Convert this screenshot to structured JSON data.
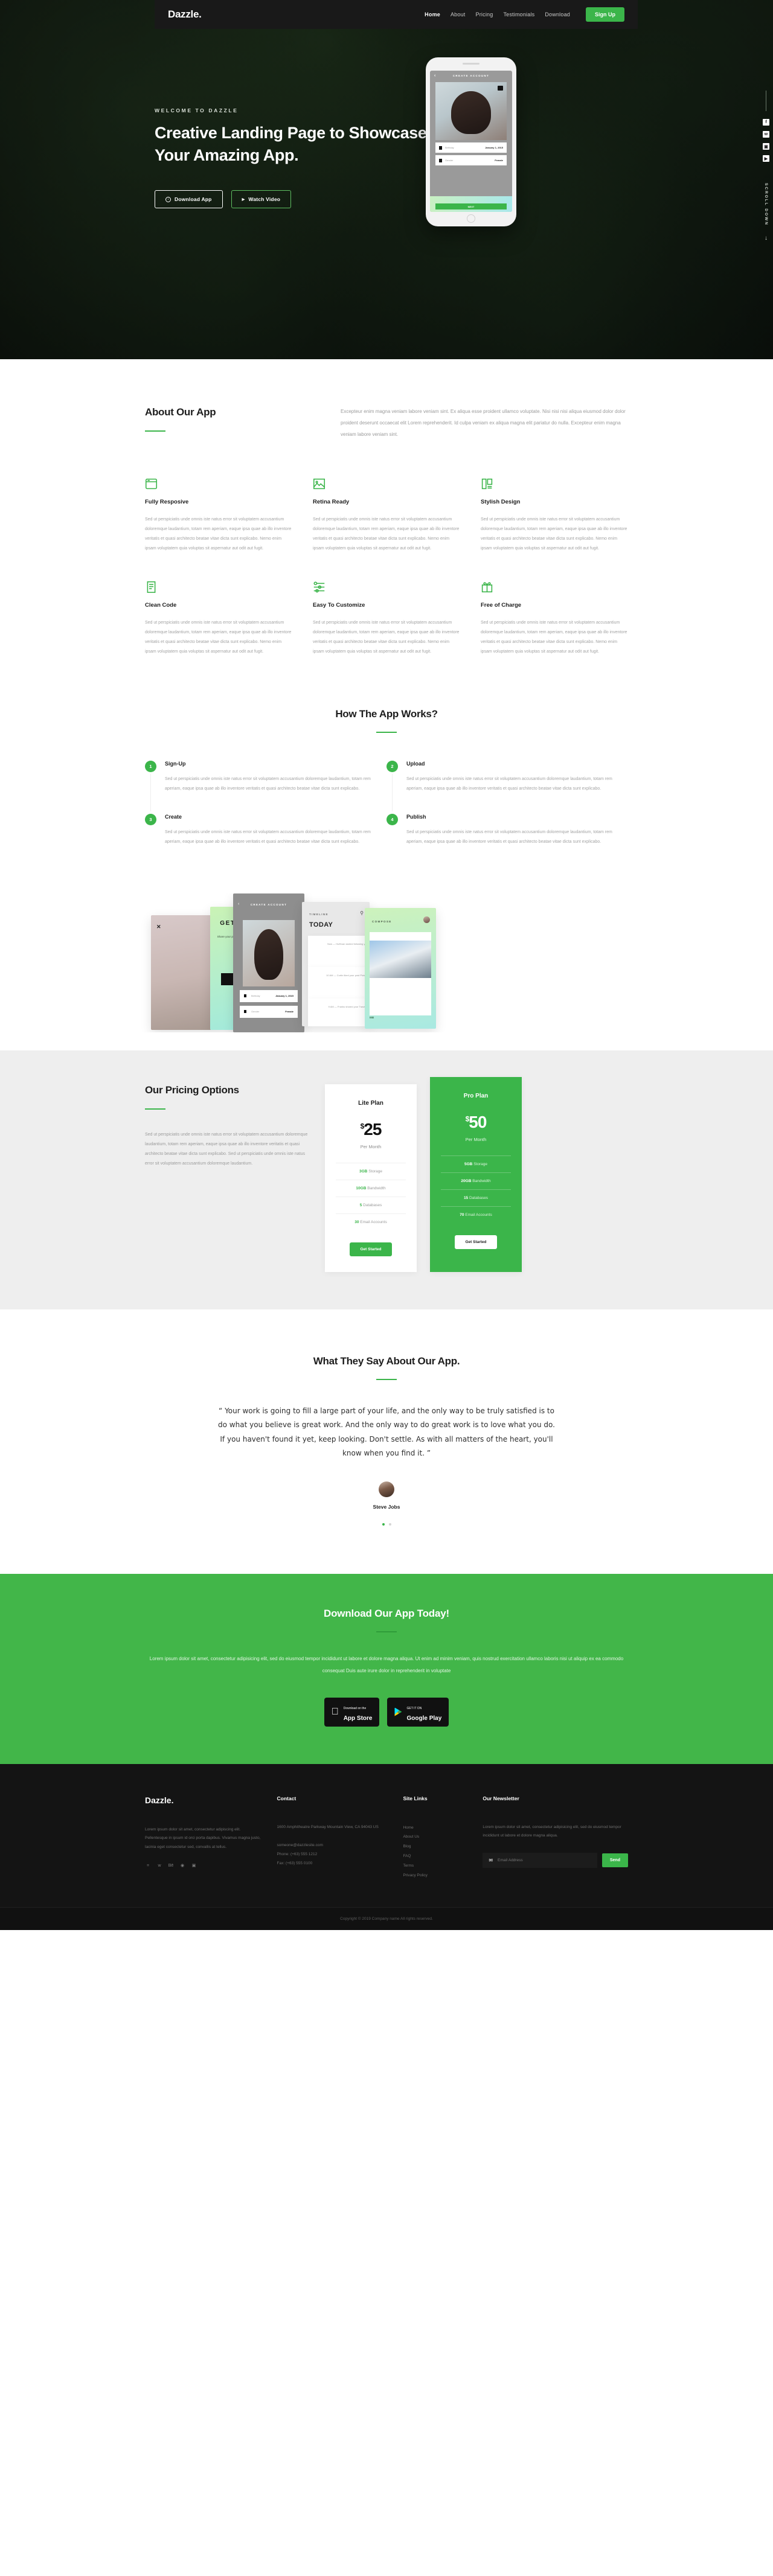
{
  "nav": {
    "brand": "Dazzle.",
    "links": [
      {
        "label": "Home",
        "active": true
      },
      {
        "label": "About",
        "active": false
      },
      {
        "label": "Pricing",
        "active": false
      },
      {
        "label": "Testimonials",
        "active": false
      },
      {
        "label": "Download",
        "active": false
      }
    ],
    "signup": "Sign Up"
  },
  "hero": {
    "eyebrow": "WELCOME TO DAZZLE",
    "heading": "Creative Landing Page to Showcase Your Amazing App.",
    "btn_download": "Download App",
    "btn_watch": "Watch Video",
    "scroll": "SCROLL DOWN",
    "social": [
      "facebook-icon",
      "twitter-icon",
      "instagram-icon",
      "youtube-icon"
    ],
    "phone": {
      "title": "CREATE ACCOUNT",
      "rows": [
        {
          "label": "Birthday",
          "value": "January 1, 2015"
        },
        {
          "label": "Gender",
          "value": "Female"
        }
      ],
      "cta": "NEXT"
    }
  },
  "about": {
    "title": "About Our App",
    "text": "Excepteur enim magna veniam labore veniam sint. Ex aliqua esse proident ullamco voluptate. Nisi nisi nisi aliqua eiusmod dolor dolor proident deserunt occaecat elit Lorem reprehenderit. Id culpa veniam ex aliqua magna elit pariatur do nulla. Excepteur enim magna veniam labore veniam sint."
  },
  "features": {
    "body": "Sed ut perspiciatis unde omnis iste natus error sit voluptatem accusantium doloremque laudantium, totam rem aperiam, eaque ipsa quae ab illo inventore veritatis et quasi architecto beatae vitae dicta sunt explicabo. Nemo enim ipsam voluptatem quia voluptas sit aspernatur aut odit aut fugit.",
    "items": [
      {
        "title": "Fully Resposive",
        "icon": "browser-window-icon"
      },
      {
        "title": "Retina Ready",
        "icon": "image-icon"
      },
      {
        "title": "Stylish Design",
        "icon": "palette-icon"
      },
      {
        "title": "Clean Code",
        "icon": "document-lines-icon"
      },
      {
        "title": "Easy To Customize",
        "icon": "sliders-icon"
      },
      {
        "title": "Free of Charge",
        "icon": "gift-icon"
      }
    ]
  },
  "how": {
    "title": "How The App Works?",
    "body": "Sed ut perspiciatis unde omnis iste natus error sit voluptatem accusantium doloremque laudantium, totam rem aperiam, eaque ipsa quae ab illo inventore veritatis et quasi architecto beatae vitae dicta sunt explicabo.",
    "steps": [
      {
        "num": "1",
        "title": "Sign-Up"
      },
      {
        "num": "2",
        "title": "Upload"
      },
      {
        "num": "3",
        "title": "Create"
      },
      {
        "num": "4",
        "title": "Publish"
      }
    ]
  },
  "shots": {
    "s2_title": "GET STARTED",
    "s2_sub": "Share your photos, videos and stories with your friends.",
    "s3_title": "CREATE ACCOUNT",
    "s3_rows": [
      {
        "label": "Birthday",
        "value": "January 1, 2015"
      },
      {
        "label": "Gender",
        "value": "Female"
      }
    ],
    "s4_tl": "TIMELINE",
    "s4_today": "TODAY",
    "s4_cards": [
      "Now — Huffman started following you",
      "10 AM — Curtin liked your post Pictures",
      "9 AM — Franks shared your Travels"
    ],
    "s5_compose": "COMPOSE",
    "s5_mb": "MB"
  },
  "pricing": {
    "title": "Our Pricing Options",
    "text": "Sed ut perspiciatis unde omnis iste natus error sit voluptatem accusantium doloremque laudantium, totam rem aperiam, eaque ipsa quae ab illo inventore veritatis et quasi architecto beatae vitae dicta sunt explicabo. Sed ut perspiciatis unde omnis iste natus error sit voluptatem accusantium doloremque laudantium.",
    "plans": [
      {
        "name": "Lite Plan",
        "currency": "$",
        "price": "25",
        "period": "Per Month",
        "features": [
          {
            "value": "3GB",
            "label": " Storage"
          },
          {
            "value": "10GB",
            "label": " Bandwidth"
          },
          {
            "value": "5",
            "label": " Databases"
          },
          {
            "value": "30",
            "label": " Email Accounts"
          }
        ],
        "cta": "Get Started",
        "featured": false
      },
      {
        "name": "Pro Plan",
        "currency": "$",
        "price": "50",
        "period": "Per Month",
        "features": [
          {
            "value": "5GB",
            "label": " Storage"
          },
          {
            "value": "20GB",
            "label": " Bandwidth"
          },
          {
            "value": "15",
            "label": " Databases"
          },
          {
            "value": "70",
            "label": " Email Accounts"
          }
        ],
        "cta": "Get Started",
        "featured": true
      }
    ]
  },
  "testimonials": {
    "title": "What They Say About Our App.",
    "quote": "“ Your work is going to fill a large part of your life, and the only way to be truly satisfied is to do what you believe is great work. And the only way to do great work is to love what you do. If you haven't found it yet, keep looking. Don't settle. As with all matters of the heart, you'll know when you find it. ”",
    "author": "Steve Jobs",
    "dots": 2,
    "active_dot": 0
  },
  "cta": {
    "title": "Download Our App Today!",
    "text": "Lorem ipsum dolor sit amet, consectetur adipisicing elit, sed do eiusmod tempor incididunt ut labore et dolore magna aliqua. Ut enim ad minim veniam, quis nostrud exercitation ullamco laboris nisi ut aliquip ex ea commodo consequat Duis aute irure dolor in reprehenderit in voluptate",
    "store_apple_small": "Download on the",
    "store_apple_big": "App Store",
    "store_google_small": "GET IT ON",
    "store_google_big": "Google Play"
  },
  "footer": {
    "brand": "Dazzle.",
    "about": "Lorem ipsum dolor sit amet, consectetur adipiscing elit. Pellentesque in ipsum id orci porta dapibus. Vivamus magna justo, lacinia eget consectetur sed, convallis at tellus.",
    "socials": [
      "facebook-icon",
      "twitter-icon",
      "behance-icon",
      "dribbble-icon",
      "instagram-icon"
    ],
    "contact_title": "Contact",
    "address": "1600 Amphitheatre Parkway Mountain View, CA 94043 US",
    "email": "someone@dazzlesite.com",
    "phone": "Phone: (+63) 555 1212",
    "fax": "Fax: (+63) 555 0100",
    "links_title": "Site Links",
    "links": [
      "Home",
      "About Us",
      "Blog",
      "FAQ",
      "Terms",
      "Privacy Policy"
    ],
    "newsletter_title": "Our Newsletter",
    "newsletter_text": "Lorem ipsum dolor sit amet, consectetur adipisicing elit, sed do eiusmod tempor incididunt ut labore et dolore magna aliqua.",
    "email_placeholder": "Email Address",
    "send": "Send",
    "copyright": "Copyright © 2019 Company name All rights reserved."
  },
  "colors": {
    "accent": "#3bb54a",
    "dark": "#141414",
    "light_gray": "#eeeeee"
  }
}
